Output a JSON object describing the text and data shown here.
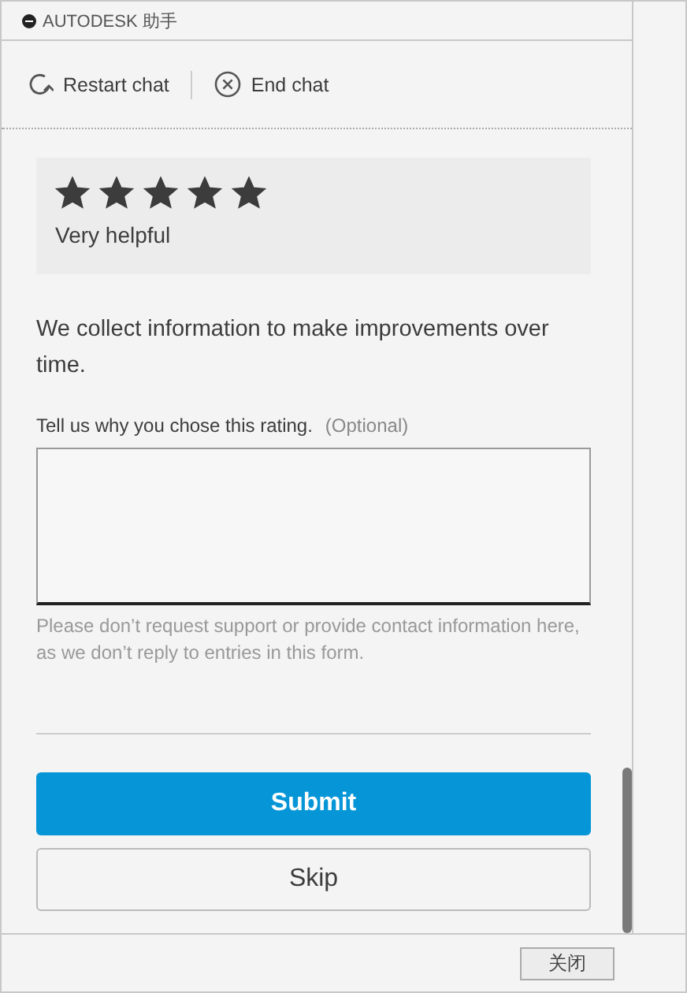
{
  "window": {
    "title": "AUTODESK 助手"
  },
  "toolbar": [
    {
      "kind": "restart",
      "label": "Restart chat"
    },
    {
      "kind": "end",
      "label": "End chat"
    }
  ],
  "rating": {
    "stars": 5,
    "label": "Very helpful"
  },
  "info": "We collect information to make improvements over time.",
  "feedback": {
    "label": "Tell us why you chose this rating.",
    "optional": "(Optional)",
    "hint": "Please don’t request support or provide contact information here, as we don’t reply to entries in this form."
  },
  "buttons": [
    {
      "kind": "primary",
      "label": "Submit"
    },
    {
      "kind": "secondary",
      "label": "Skip"
    }
  ],
  "footer": {
    "button": "关闭"
  }
}
